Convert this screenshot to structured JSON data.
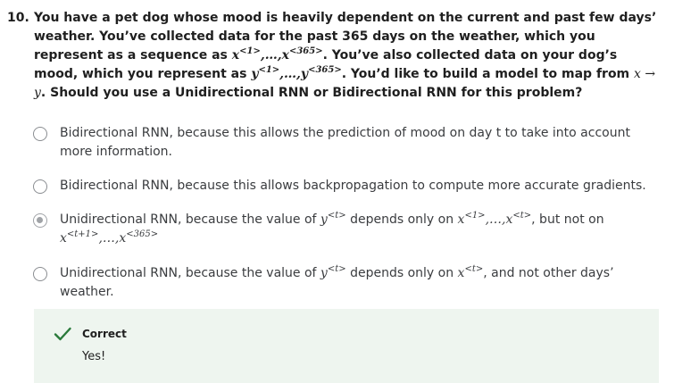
{
  "question": {
    "number": "10.",
    "p1": "You have a pet dog whose mood is heavily dependent on the current and past few days’ weather. You’ve collected data for the past 365 days on the weather, which you represent as a sequence as ",
    "x_seq_a": "x",
    "x_sup_a": "<1>",
    "x_dots": ",…,",
    "x_seq_b": "x",
    "x_sup_b": "<365>",
    "p2": ". You’ve also collected data on your dog’s mood, which you represent as ",
    "y_seq_a": "y",
    "y_sup_a": "<1>",
    "y_dots": ",…,",
    "y_seq_b": "y",
    "y_sup_b": "<365>",
    "p3": ". You’d like to build a model to map from ",
    "map_expr": "x → y",
    "p4": ". Should you use a Unidirectional RNN or Bidirectional RNN for this problem?"
  },
  "options": [
    {
      "text": "Bidirectional RNN, because this allows the prediction of mood on day t to take into account more information.",
      "selected": false
    },
    {
      "text": "Bidirectional RNN, because this allows backpropagation to compute more accurate gradients.",
      "selected": false
    },
    {
      "t1": "Unidirectional RNN, because the value of ",
      "y": "y",
      "y_sup": "<t>",
      "t2": " depends only on ",
      "xa": "x",
      "xa_sup": "<1>",
      "dots1": ",…,",
      "xb": "x",
      "xb_sup": "<t>",
      "t3": ", but not on ",
      "xc": "x",
      "xc_sup": "<t+1>",
      "dots2": ",…,",
      "xd": "x",
      "xd_sup": "<365>",
      "selected": true
    },
    {
      "t1": "Unidirectional RNN, because the value of ",
      "y": "y",
      "y_sup": "<t>",
      "t2": " depends only on ",
      "x": "x",
      "x_sup": "<t>",
      "t3": ", and not other days’ weather.",
      "selected": false
    }
  ],
  "feedback": {
    "status": "Correct",
    "message": "Yes!",
    "icon": "checkmark-icon",
    "icon_color": "#2a7a3b",
    "background": "#eef5ef"
  }
}
